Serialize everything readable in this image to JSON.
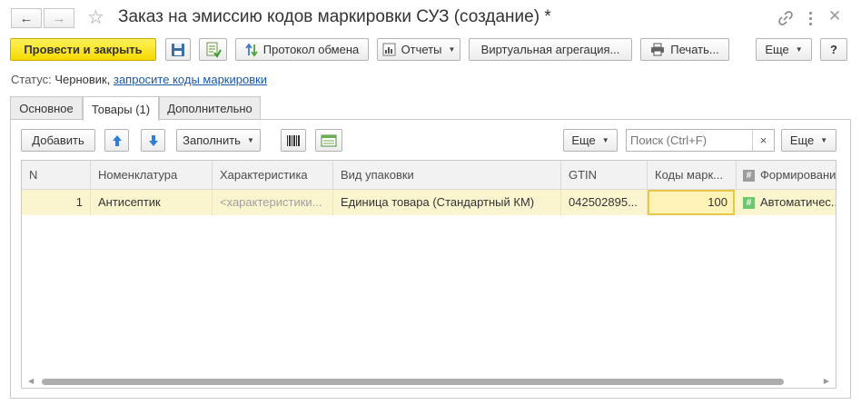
{
  "window": {
    "title": "Заказ на эмиссию кодов маркировки СУЗ (создание) *"
  },
  "toolbar": {
    "post_close": "Провести и закрыть",
    "exchange_log": "Протокол обмена",
    "reports": "Отчеты",
    "virtual_aggregation": "Виртуальная агрегация...",
    "print": "Печать...",
    "more": "Еще",
    "help": "?"
  },
  "status": {
    "label": "Статус:",
    "value": "Черновик,",
    "link": "запросите коды маркировки"
  },
  "tabs": [
    {
      "label": "Основное"
    },
    {
      "label": "Товары (1)"
    },
    {
      "label": "Дополнительно"
    }
  ],
  "table_toolbar": {
    "add": "Добавить",
    "fill": "Заполнить",
    "more_left": "Еще",
    "more_right": "Еще"
  },
  "search": {
    "placeholder": "Поиск (Ctrl+F)",
    "clear": "×"
  },
  "grid": {
    "columns": [
      "N",
      "Номенклатура",
      "Характеристика",
      "Вид упаковки",
      "GTIN",
      "Коды марк...",
      "Формировани..."
    ],
    "rows": [
      {
        "n": "1",
        "nomenclature": "Антисептик",
        "characteristic": "<характеристики...",
        "package_type": "Единица товара (Стандартный КМ)",
        "gtin": "042502895...",
        "codes": "100",
        "formation": "Автоматичес..."
      }
    ]
  },
  "icons": {
    "back": "arrow-left-icon",
    "forward": "arrow-right-icon",
    "favorite": "star-icon",
    "link": "link-icon",
    "menu": "kebab-menu-icon",
    "close": "close-icon",
    "save": "floppy-disk-icon",
    "post": "document-post-icon",
    "up": "arrow-up-icon",
    "down": "arrow-down-icon",
    "barcode": "barcode-icon",
    "pick": "table-select-icon",
    "hash": "hash-icon"
  },
  "colors": {
    "primary_button": "#f6d900",
    "selected_row": "#fbf5cf",
    "link": "#1a59a8",
    "arrow_blue": "#2f7fd8",
    "hash_green": "#6ec66e"
  }
}
